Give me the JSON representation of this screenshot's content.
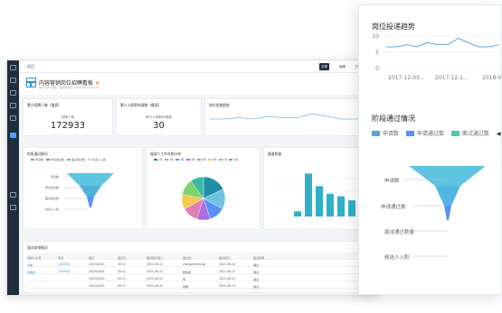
{
  "topbar": {
    "back_label": "返回",
    "share_label": "共享",
    "edit_label": "编辑",
    "print_label": "打印"
  },
  "board": {
    "title": "内容营销岗位招聘看板",
    "subtitle": "由 Leyan 创建，最近修改于 2021-06-15 10:20"
  },
  "kpis": [
    {
      "title": "累计招聘人数（整表）",
      "label": "招聘人数",
      "value": "172933"
    },
    {
      "title": "累计入职职申请数（截面）",
      "label": "累计入职职申请数",
      "value": "30"
    }
  ],
  "trend_card": {
    "title": "岗位投递趋势"
  },
  "funnel_card": {
    "title": "阶段通过情况",
    "legend": [
      "申请数",
      "申请通过数",
      "面试通过数",
      "候选人入职"
    ],
    "labels": [
      "申请数",
      "申请通过数",
      "面试通过数",
      "候选人入职"
    ]
  },
  "pie_card": {
    "title": "候选人工作年限分布",
    "legend": [
      "1年",
      "2年",
      "3年",
      "4年",
      "5年",
      "6年",
      "7年",
      "8年"
    ]
  },
  "bar_card": {
    "title": "渠道质量"
  },
  "table_card": {
    "title": "面试安排情况",
    "headers": [
      "候选人名称",
      "申请",
      "面试",
      "面试日",
      "面试官负责人",
      "面试地",
      "面试结论",
      "面试结果"
    ],
    "rows": [
      [
        "沈航",
        "1009351",
        "10/15/2021",
        "00:11",
        "2021-06-15",
        "zhangshanming",
        "2021-06-15",
        "通过"
      ],
      [
        "谭晓龙",
        "1109352",
        "10/15/2021",
        "00:11",
        "2021-06-15",
        "杨建鑫",
        "2021-06-15",
        "通过"
      ],
      [
        "",
        "",
        "10/15/2021",
        "00:11",
        "2021-06-15",
        "李",
        "2021-06-15",
        "通过"
      ],
      [
        "",
        "",
        "10/15/2021",
        "00:11",
        "2021-06-15",
        "张明",
        "2021-06-15",
        "通过"
      ]
    ]
  },
  "panel": {
    "trend_title": "岗位投递趋势",
    "trend_ticks": [
      "10",
      "5",
      "0"
    ],
    "trend_x": [
      "2017-12-03...",
      "2017-12-1...",
      "2018-01-0..."
    ],
    "funnel_title": "阶段通过情况",
    "legend": [
      "申请数",
      "申请通过数",
      "面试通过数"
    ],
    "funnel_labels": [
      "申请数",
      "申请通过数",
      "面试通过数量",
      "候选人入职"
    ]
  },
  "colors": {
    "sidebar": "#1f2d3d",
    "accent": "#2f8fdd",
    "funnel1": "#5fa6d6",
    "funnel2": "#5b8ff9",
    "funnel3": "#52c4b0",
    "bar": "#2fb0c8"
  },
  "chart_data": [
    {
      "type": "line",
      "title": "岗位投递趋势",
      "x": [
        "2017-12-03",
        "2017-12-1",
        "2018-01-0"
      ],
      "series": [
        {
          "values": [
            10,
            10,
            11,
            10,
            12,
            11,
            11,
            14,
            12,
            10,
            10,
            11
          ]
        }
      ],
      "ylim": [
        0,
        15
      ]
    },
    {
      "type": "bar",
      "title": "渠道质量",
      "categories": [
        "渠道1",
        "渠道2",
        "渠道3",
        "渠道4",
        "渠道5",
        "渠道6"
      ],
      "values": [
        10,
        85,
        60,
        45,
        40,
        32
      ]
    },
    {
      "type": "pie",
      "title": "候选人工作年限分布",
      "categories": [
        "1年",
        "2年",
        "3年",
        "4年",
        "5年",
        "6年",
        "7年",
        "8年"
      ],
      "values": [
        18,
        15,
        12,
        10,
        12,
        11,
        12,
        10
      ]
    }
  ]
}
